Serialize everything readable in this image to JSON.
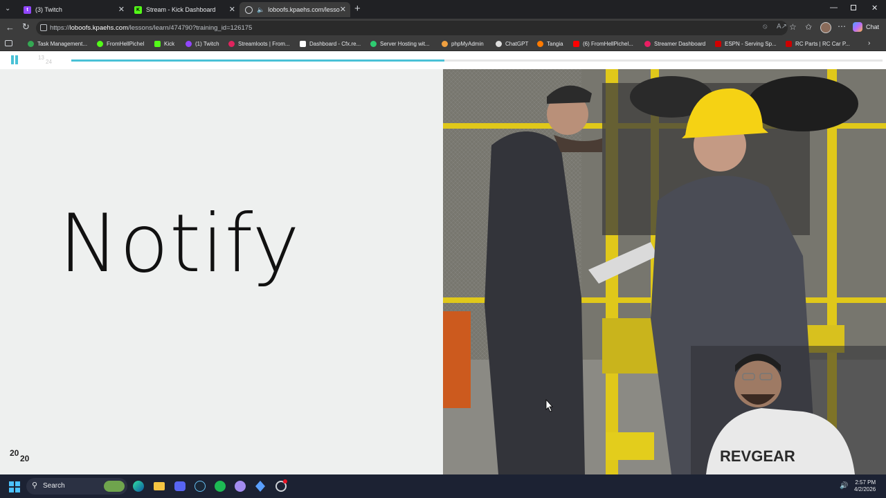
{
  "browser": {
    "tabs": [
      {
        "label": "(3) Twitch",
        "color": "#9146ff"
      },
      {
        "label": "Stream - Kick Dashboard",
        "color": "#53fc18"
      },
      {
        "label": "loboofs.kpaehs.com/lessons/l",
        "color": "#9aa0a6"
      }
    ],
    "new_tab": "+",
    "url": {
      "scheme": "https://",
      "host": "loboofs.kpaehs.com",
      "path": "/lessons/learn/474790?training_id=126175"
    },
    "chat_label": "Chat",
    "bookmarks": [
      {
        "label": "Task Management...",
        "color": "#34a853"
      },
      {
        "label": "FromHellPichel",
        "color": "#53fc18"
      },
      {
        "label": "Kick",
        "color": "#53fc18"
      },
      {
        "label": "(1) Twitch",
        "color": "#9146ff"
      },
      {
        "label": "Streamloots | From...",
        "color": "#e0245e"
      },
      {
        "label": "Dashboard - Cfx.re...",
        "color": "#ffffff"
      },
      {
        "label": "Server Hosting wit...",
        "color": "#2ecc71"
      },
      {
        "label": "phpMyAdmin",
        "color": "#f0a040"
      },
      {
        "label": "ChatGPT",
        "color": "#dddddd"
      },
      {
        "label": "Tangia",
        "color": "#ff7a00"
      },
      {
        "label": "(6) FromHellPichel...",
        "color": "#ff0000"
      },
      {
        "label": "Streamer Dashboard",
        "color": "#e91e63"
      },
      {
        "label": "ESPN - Serving Sp...",
        "color": "#d00000"
      },
      {
        "label": "RC Parts | RC Car P...",
        "color": "#cc0000"
      }
    ]
  },
  "player": {
    "slide_counter_current": "13",
    "slide_counter_total": "24",
    "progress_fraction": 0.46,
    "accent": "#49c1d6"
  },
  "slide": {
    "title": "Notify",
    "logo_top": "20",
    "logo_bottom": "20"
  },
  "webcam": {
    "shirt_text": "REVGEAR"
  },
  "taskbar": {
    "search_placeholder": "Search",
    "time": "2:57 PM",
    "date": "4/2/2026"
  }
}
